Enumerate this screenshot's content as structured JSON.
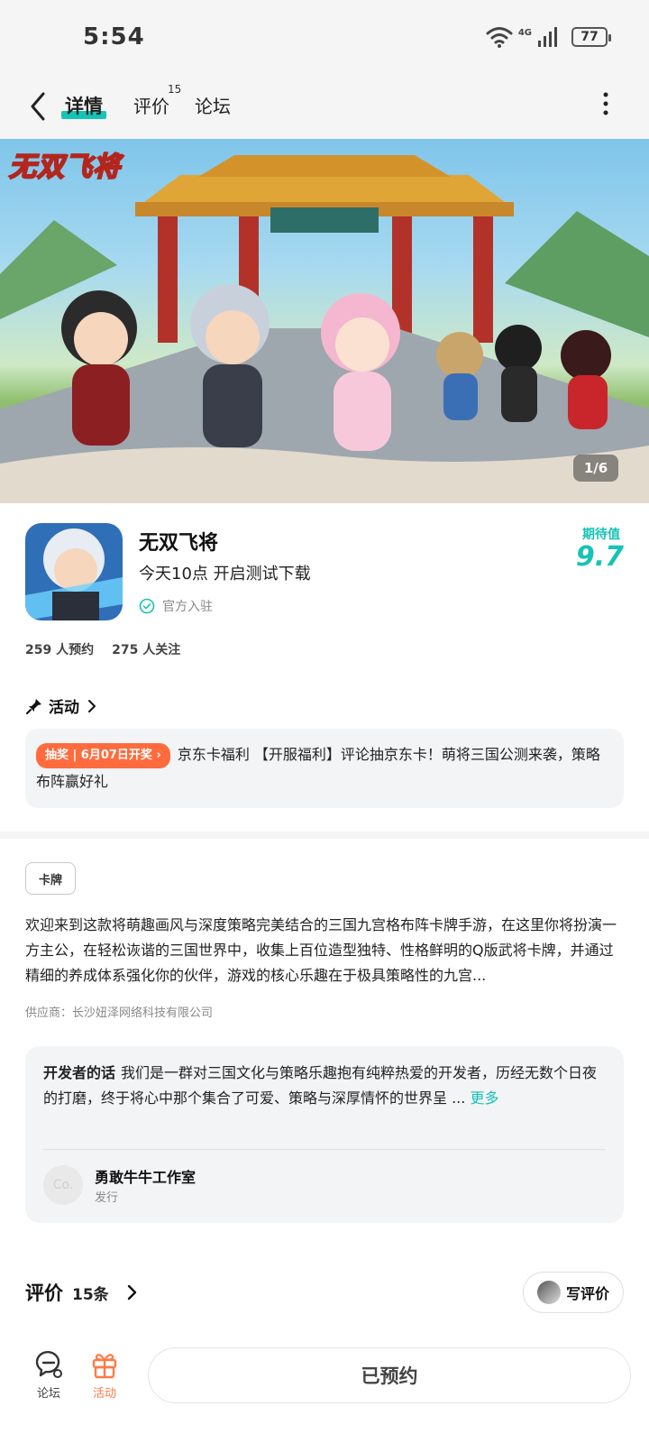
{
  "status_bar": {
    "time": "5:54",
    "network": "4G",
    "battery": "77"
  },
  "header": {
    "tabs": [
      {
        "label": "详情"
      },
      {
        "label": "评价",
        "badge": "15"
      },
      {
        "label": "论坛"
      }
    ]
  },
  "banner": {
    "logo_text": "无双飞将",
    "counter": "1/6"
  },
  "game": {
    "name": "无双飞将",
    "tagline": "今天10点 开启测试下载",
    "official_label": "官方入驻",
    "score_label": "期待值",
    "score": "9.7",
    "reservations": "259 人预约",
    "followers": "275 人关注"
  },
  "activity": {
    "title": "活动",
    "badge": "抽奖 | 6月07日开奖",
    "text": "京东卡福利 【开服福利】评论抽京东卡！萌将三国公测来袭，策略布阵赢好礼"
  },
  "description": {
    "tag": "卡牌",
    "text": "欢迎来到这款将萌趣画风与深度策略完美结合的三国九宫格布阵卡牌手游，在这里你将扮演一方主公，在轻松诙谐的三国世界中，收集上百位造型独特、性格鲜明的Q版武将卡牌，并通过精细的养成体系强化你的伙伴，游戏的核心乐趣在于极具策略性的九宫...",
    "supplier": "供应商：长沙妞泽网络科技有限公司"
  },
  "developer": {
    "label": "开发者的话",
    "text": "我们是一群对三国文化与策略乐趣抱有纯粹热爱的开发者，历经无数个日夜的打磨，终于将心中那个集合了可爱、策略与深厚情怀的世界呈 ...",
    "more": "更多",
    "avatar_text": "Co.",
    "name": "勇敢牛牛工作室",
    "role": "发行"
  },
  "reviews": {
    "title": "评价",
    "count": "15条",
    "write_label": "写评价"
  },
  "bottom_bar": {
    "forum_label": "论坛",
    "activity_label": "活动",
    "reserve_label": "已预约"
  },
  "colors": {
    "accent": "#17c2b6",
    "orange": "#ff6b3d"
  },
  "icons": [
    "back-arrow-icon",
    "more-vertical-icon",
    "wifi-icon",
    "signal-icon",
    "verified-check-icon",
    "pin-icon",
    "chevron-right-icon",
    "forum-chat-icon",
    "gift-icon"
  ]
}
